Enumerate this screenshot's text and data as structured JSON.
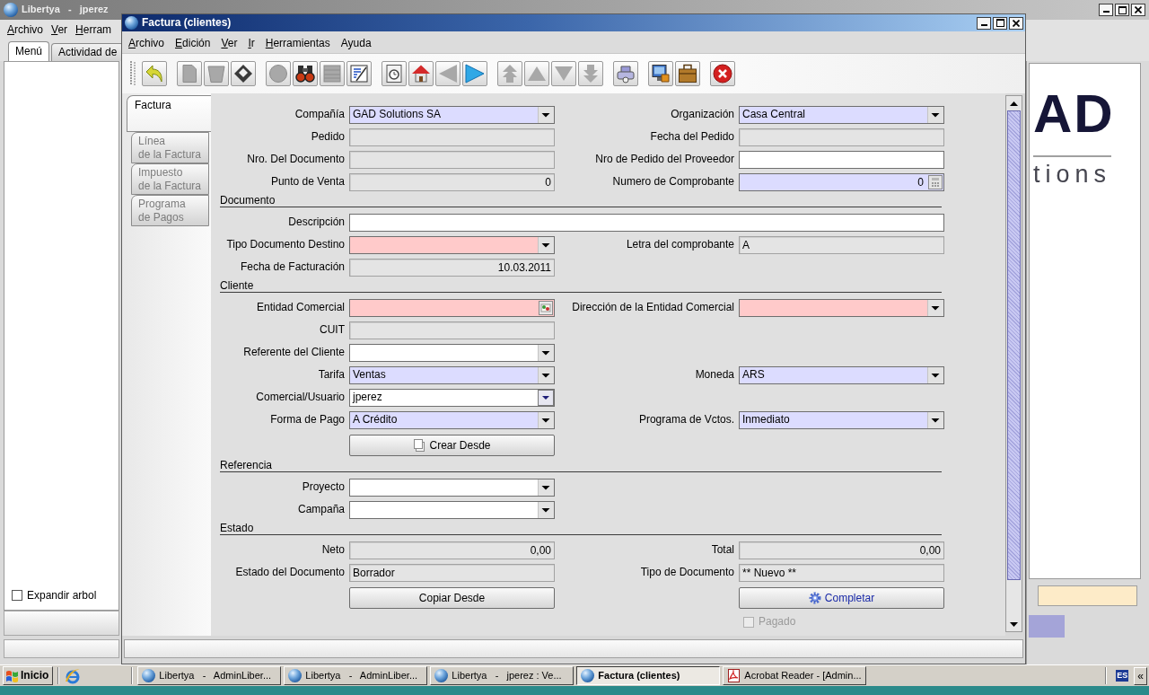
{
  "desktop_window": {
    "title": "Libertya   -   jperez",
    "menu": [
      {
        "label": "Archivo",
        "mnemonic": true
      },
      {
        "label": "Ver",
        "mnemonic": true
      },
      {
        "label": "Herram",
        "mnemonic": true
      }
    ],
    "tabs": [
      {
        "label": "Menú",
        "selected": true
      },
      {
        "label": "Actividad de",
        "selected": false
      }
    ],
    "expand_tree": {
      "label": "Expandir arbol",
      "checked": false
    },
    "logo": {
      "mark": "AD",
      "tagline": "tions"
    }
  },
  "invoice_window": {
    "title": "Factura (clientes)",
    "menu": [
      {
        "label": "Archivo",
        "mnemonic": true
      },
      {
        "label": "Edición",
        "mnemonic": true
      },
      {
        "label": "Ver",
        "mnemonic": true
      },
      {
        "label": "Ir",
        "mnemonic": true
      },
      {
        "label": "Herramientas",
        "mnemonic": true
      },
      {
        "label": "Ayuda",
        "mnemonic": false
      }
    ],
    "toolbar": [
      [
        {
          "kind": "undo",
          "disabled": false
        }
      ],
      [
        {
          "kind": "new",
          "disabled": true
        },
        {
          "kind": "delete",
          "disabled": true
        },
        {
          "kind": "save",
          "disabled": false
        }
      ],
      [
        {
          "kind": "refresh",
          "disabled": true
        },
        {
          "kind": "find",
          "disabled": false
        },
        {
          "kind": "grid",
          "disabled": true
        },
        {
          "kind": "report",
          "disabled": false
        }
      ],
      [
        {
          "kind": "history",
          "disabled": false
        },
        {
          "kind": "home",
          "disabled": false
        },
        {
          "kind": "back",
          "disabled": true
        },
        {
          "kind": "forward",
          "disabled": false
        }
      ],
      [
        {
          "kind": "first",
          "disabled": true
        },
        {
          "kind": "previous",
          "disabled": true
        },
        {
          "kind": "next",
          "disabled": true
        },
        {
          "kind": "last",
          "disabled": true
        }
      ],
      [
        {
          "kind": "print",
          "disabled": false
        }
      ],
      [
        {
          "kind": "monitor",
          "disabled": false
        },
        {
          "kind": "archive",
          "disabled": false
        }
      ],
      [
        {
          "kind": "close",
          "disabled": false
        }
      ]
    ],
    "tabs": [
      {
        "lines": [
          "Factura"
        ],
        "selected": true,
        "disabled": false
      },
      {
        "lines": [
          "Línea",
          "de la Factura"
        ],
        "selected": false,
        "disabled": true
      },
      {
        "lines": [
          "Impuesto",
          "de la Factura"
        ],
        "selected": false,
        "disabled": true
      },
      {
        "lines": [
          "Programa",
          "de Pagos"
        ],
        "selected": false,
        "disabled": true
      }
    ],
    "form": [
      {
        "kind": "pair",
        "left": {
          "label": "Compañía",
          "kind": "combo",
          "mandatory": true,
          "readonly": false,
          "value": "GAD Solutions SA"
        },
        "right": {
          "label": "Organización",
          "kind": "combo",
          "mandatory": true,
          "readonly": false,
          "value": "Casa Central"
        }
      },
      {
        "kind": "pair",
        "left": {
          "label": "Pedido",
          "kind": "text",
          "readonly": true
        },
        "right": {
          "label": "Fecha del Pedido",
          "kind": "text",
          "readonly": true
        }
      },
      {
        "kind": "pair",
        "left": {
          "label": "Nro. Del Documento",
          "kind": "text",
          "readonly": true
        },
        "right": {
          "label": "Nro de Pedido del Proveedor",
          "kind": "text",
          "mandatory": false,
          "readonly": false
        }
      },
      {
        "kind": "pair",
        "left": {
          "label": "Punto de Venta",
          "kind": "number",
          "readonly": true,
          "value": "0"
        },
        "right": {
          "label": "Numero de Comprobante",
          "kind": "calc",
          "mandatory": true,
          "readonly": false,
          "value": "0"
        }
      },
      {
        "kind": "section",
        "title": "Documento"
      },
      {
        "kind": "wide",
        "left": {
          "label": "Descripción",
          "kind": "text",
          "mandatory": false,
          "readonly": false
        }
      },
      {
        "kind": "pair",
        "left": {
          "label": "Tipo Documento Destino",
          "kind": "combo",
          "mandatory": true,
          "readonly": false
        },
        "right": {
          "label": "Letra del comprobante",
          "kind": "text",
          "readonly": true,
          "value": "A"
        }
      },
      {
        "kind": "pair",
        "left": {
          "label": "Fecha de Facturación",
          "kind": "number",
          "readonly": true,
          "value": "10.03.2011"
        }
      },
      {
        "kind": "section",
        "title": "Cliente"
      },
      {
        "kind": "pair",
        "left": {
          "label": "Entidad Comercial",
          "kind": "search",
          "mandatory": true,
          "readonly": false
        },
        "right": {
          "label": "Dirección de la Entidad Comercial",
          "kind": "combo",
          "mandatory": true,
          "readonly": false
        }
      },
      {
        "kind": "pair",
        "left": {
          "label": "CUIT",
          "kind": "text",
          "readonly": true
        }
      },
      {
        "kind": "pair",
        "left": {
          "label": "Referente del Cliente",
          "kind": "combo",
          "mandatory": false,
          "readonly": false
        }
      },
      {
        "kind": "pair",
        "left": {
          "label": "Tarifa",
          "kind": "combo",
          "mandatory": true,
          "readonly": false,
          "value": "Ventas"
        },
        "right": {
          "label": "Moneda",
          "kind": "combo",
          "mandatory": true,
          "readonly": false,
          "value": "ARS"
        }
      },
      {
        "kind": "pair",
        "left": {
          "label": "Comercial/Usuario",
          "kind": "editcombo",
          "mandatory": false,
          "readonly": false,
          "value": "jperez"
        }
      },
      {
        "kind": "pair",
        "left": {
          "label": "Forma de Pago",
          "kind": "combo",
          "mandatory": true,
          "readonly": false,
          "value": "A Crédito"
        },
        "right": {
          "label": "Programa de Vctos.",
          "kind": "combo",
          "mandatory": true,
          "readonly": false,
          "value": "Inmediato"
        }
      },
      {
        "kind": "pair",
        "left": {
          "label": "Crear Desde",
          "kind": "createbutton"
        }
      },
      {
        "kind": "section",
        "title": "Referencia"
      },
      {
        "kind": "pair",
        "left": {
          "label": "Proyecto",
          "kind": "combo",
          "mandatory": false,
          "readonly": false
        }
      },
      {
        "kind": "pair",
        "left": {
          "label": "Campaña",
          "kind": "combo",
          "mandatory": false,
          "readonly": false
        }
      },
      {
        "kind": "section",
        "title": "Estado"
      },
      {
        "kind": "pair",
        "left": {
          "label": "Neto",
          "kind": "number",
          "readonly": true,
          "value": "0,00"
        },
        "right": {
          "label": "Total",
          "kind": "number",
          "readonly": true,
          "value": "0,00"
        }
      },
      {
        "kind": "pair",
        "left": {
          "label": "Estado del Documento",
          "kind": "text",
          "readonly": true,
          "value": "Borrador"
        },
        "right": {
          "label": "Tipo de Documento",
          "kind": "text",
          "readonly": true,
          "value": "** Nuevo **"
        }
      },
      {
        "kind": "pair",
        "left": {
          "label": "Copiar Desde",
          "kind": "button"
        },
        "right": {
          "label": "Completar",
          "kind": "processbutton"
        }
      },
      {
        "kind": "pair",
        "right": {
          "label": "Pagado",
          "kind": "checkbox",
          "checked": false,
          "disabled": true
        }
      }
    ]
  },
  "taskbar": {
    "start": "Inicio",
    "tasks": [
      {
        "kind": "app",
        "title": "Libertya   -   AdminLiber...",
        "selected": false
      },
      {
        "kind": "app",
        "title": "Libertya   -   AdminLiber...",
        "selected": false
      },
      {
        "kind": "app",
        "title": "Libertya   -   jperez : Ve...",
        "selected": false
      },
      {
        "kind": "app",
        "title": "Factura (clientes)",
        "selected": true
      },
      {
        "kind": "pdf",
        "title": "Acrobat Reader - [Admin...",
        "selected": false
      }
    ],
    "language": "ES",
    "expand": "«"
  }
}
